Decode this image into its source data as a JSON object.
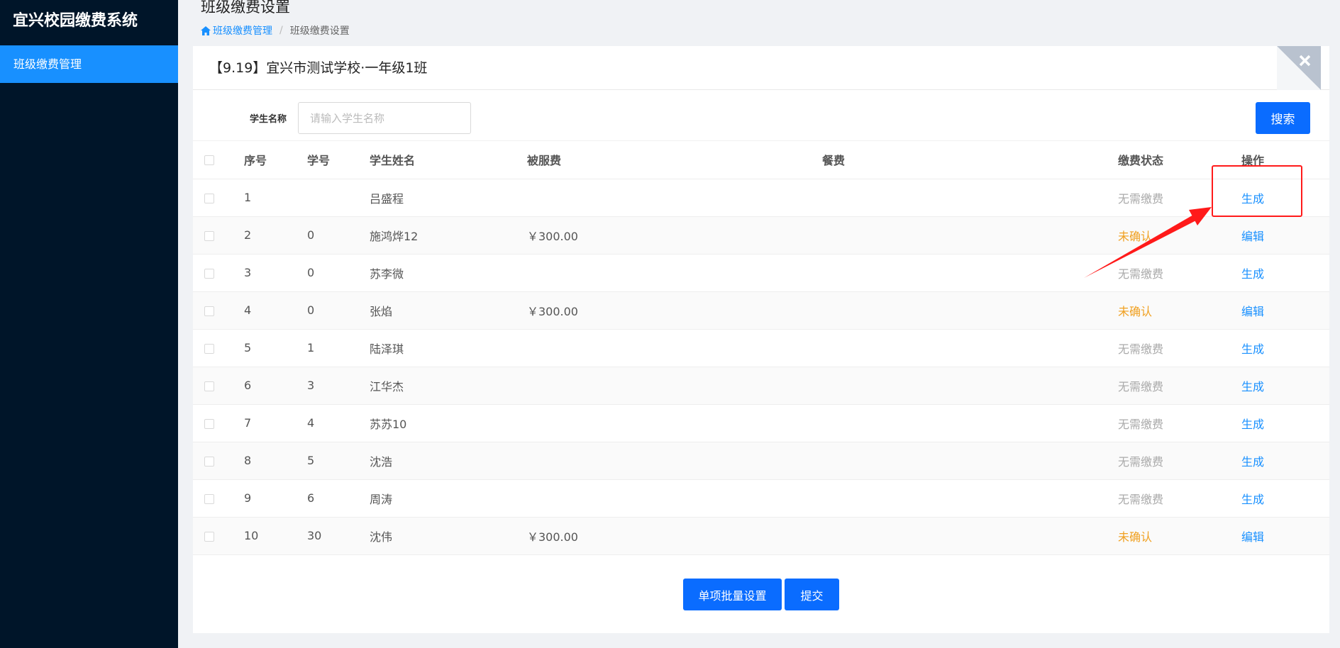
{
  "sidebar": {
    "app_title": "宜兴校园缴费系统",
    "items": [
      {
        "label": "班级缴费管理"
      }
    ]
  },
  "header": {
    "title": "班级缴费设置",
    "breadcrumb": [
      "班级缴费管理",
      "班级缴费设置"
    ]
  },
  "card": {
    "title": "【9.19】宜兴市测试学校·一年级1班"
  },
  "search": {
    "label": "学生名称",
    "placeholder": "请输入学生名称",
    "value": "",
    "button_label": "搜索"
  },
  "table": {
    "columns": [
      "序号",
      "学号",
      "学生姓名",
      "被服费",
      "餐费",
      "缴费状态",
      "操作"
    ],
    "rows": [
      {
        "index": "1",
        "student_no": "",
        "name": "吕盛程",
        "uniform_fee": "",
        "meal_fee": "",
        "status": "无需缴费",
        "action": "生成"
      },
      {
        "index": "2",
        "student_no": "0",
        "name": "施鸿烨12",
        "uniform_fee": "￥300.00",
        "meal_fee": "",
        "status": "未确认",
        "action": "编辑"
      },
      {
        "index": "3",
        "student_no": "0",
        "name": "苏李微",
        "uniform_fee": "",
        "meal_fee": "",
        "status": "无需缴费",
        "action": "生成"
      },
      {
        "index": "4",
        "student_no": "0",
        "name": "张焰",
        "uniform_fee": "￥300.00",
        "meal_fee": "",
        "status": "未确认",
        "action": "编辑"
      },
      {
        "index": "5",
        "student_no": "1",
        "name": "陆泽琪",
        "uniform_fee": "",
        "meal_fee": "",
        "status": "无需缴费",
        "action": "生成"
      },
      {
        "index": "6",
        "student_no": "3",
        "name": "江华杰",
        "uniform_fee": "",
        "meal_fee": "",
        "status": "无需缴费",
        "action": "生成"
      },
      {
        "index": "7",
        "student_no": "4",
        "name": "苏苏10",
        "uniform_fee": "",
        "meal_fee": "",
        "status": "无需缴费",
        "action": "生成"
      },
      {
        "index": "8",
        "student_no": "5",
        "name": "沈浩",
        "uniform_fee": "",
        "meal_fee": "",
        "status": "无需缴费",
        "action": "生成"
      },
      {
        "index": "9",
        "student_no": "6",
        "name": "周涛",
        "uniform_fee": "",
        "meal_fee": "",
        "status": "无需缴费",
        "action": "生成"
      },
      {
        "index": "10",
        "student_no": "30",
        "name": "沈伟",
        "uniform_fee": "￥300.00",
        "meal_fee": "",
        "status": "未确认",
        "action": "编辑"
      }
    ]
  },
  "footer": {
    "batch_button": "单项批量设置",
    "submit_button": "提交"
  },
  "colors": {
    "sidebar_bg": "#001529",
    "accent": "#1890ff",
    "primary_button": "#0a6cff",
    "status_pending": "#f0a020",
    "status_none": "#aaaaaa",
    "annotation": "#ff1a1a"
  },
  "icons": {
    "breadcrumb_home": "home-icon",
    "corner_close": "close-icon",
    "annotation_arrow": "arrow-icon"
  }
}
